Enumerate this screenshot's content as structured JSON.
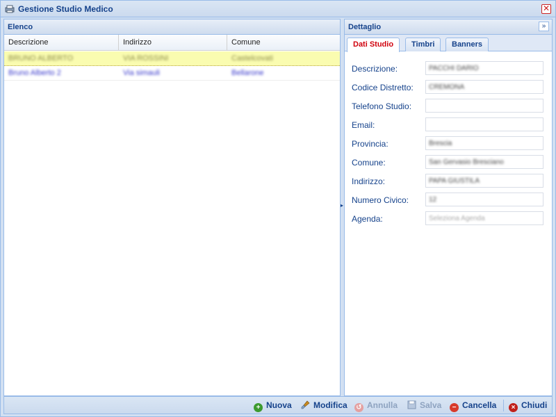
{
  "window": {
    "title": "Gestione Studio Medico",
    "close_label": "✕"
  },
  "left_panel": {
    "title": "Elenco",
    "columns": [
      "Descrizione",
      "Indirizzo",
      "Comune"
    ],
    "rows": [
      {
        "descrizione": "BRUNO ALBERTO",
        "indirizzo": "VIA ROSSINI",
        "comune": "Castelcovati",
        "selected": true
      },
      {
        "descrizione": "Bruno Alberto 2",
        "indirizzo": "Via simauli",
        "comune": "Bellarone",
        "selected": false
      }
    ]
  },
  "right_panel": {
    "title": "Dettaglio",
    "collapse_label": "»",
    "tabs": [
      {
        "label": "Dati Studio",
        "active": true
      },
      {
        "label": "Timbri",
        "active": false
      },
      {
        "label": "Banners",
        "active": false
      }
    ],
    "fields": [
      {
        "label": "Descrizione:",
        "value": "PACCHI DARIO",
        "type": "filled"
      },
      {
        "label": "Codice Distretto:",
        "value": "CREMONA",
        "type": "filled"
      },
      {
        "label": "Telefono Studio:",
        "value": "",
        "type": "empty"
      },
      {
        "label": "Email:",
        "value": "",
        "type": "empty"
      },
      {
        "label": "Provincia:",
        "value": "Brescia",
        "type": "filled"
      },
      {
        "label": "Comune:",
        "value": "San Gervasio Bresciano",
        "type": "filled"
      },
      {
        "label": "Indirizzo:",
        "value": "PAPA GIUSTILA",
        "type": "filled"
      },
      {
        "label": "Numero Civico:",
        "value": "12",
        "type": "filled"
      },
      {
        "label": "Agenda:",
        "value": "Seleziona Agenda",
        "type": "placeholder"
      }
    ]
  },
  "toolbar": {
    "buttons": [
      {
        "label": "Nuova",
        "icon": "plus-circle-icon",
        "color": "#3c9a2e",
        "disabled": false
      },
      {
        "label": "Modifica",
        "icon": "brush-icon",
        "color": "#c98a1e",
        "disabled": false
      },
      {
        "label": "Annulla",
        "icon": "undo-icon",
        "color": "#e4a0a0",
        "disabled": true
      },
      {
        "label": "Salva",
        "icon": "save-icon",
        "color": "#9fb3cf",
        "disabled": true
      },
      {
        "label": "Cancella",
        "icon": "minus-circle-icon",
        "color": "#d83a2b",
        "disabled": false
      },
      {
        "label": "Chiudi",
        "icon": "close-circle-icon",
        "color": "#c0201a",
        "disabled": false
      }
    ]
  }
}
